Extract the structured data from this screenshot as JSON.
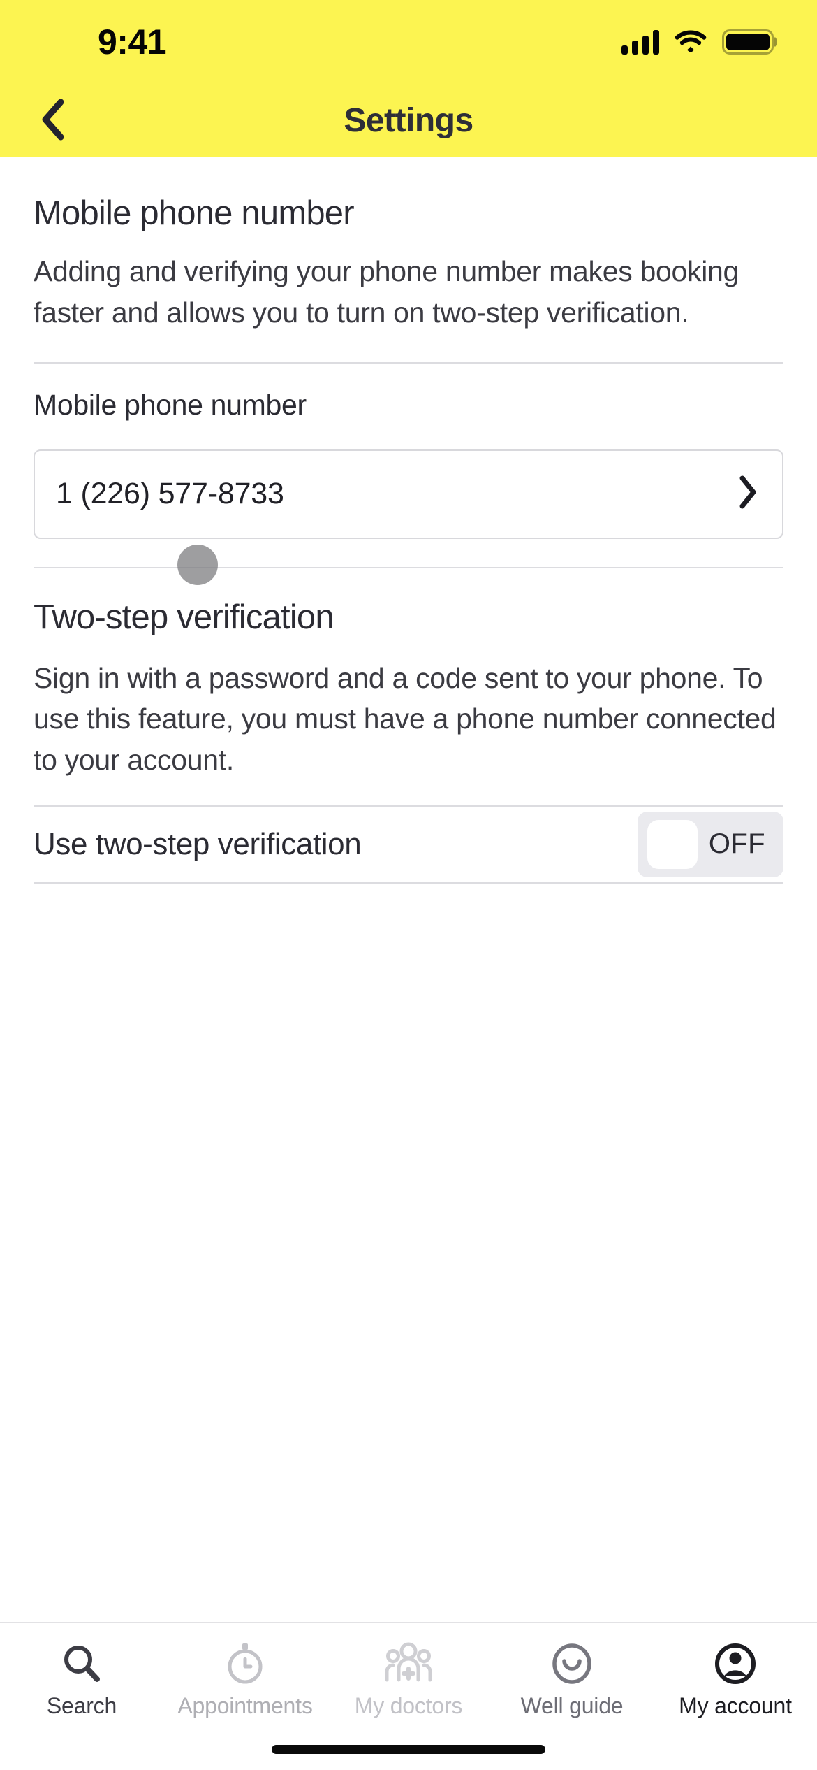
{
  "status_bar": {
    "time": "9:41",
    "cellular_icon": "cellular-signal-icon",
    "wifi_icon": "wifi-icon",
    "battery_icon": "battery-full-icon"
  },
  "header": {
    "back_icon": "chevron-left-icon",
    "title": "Settings",
    "background_color": "#FCF451",
    "title_color": "#2E2E38"
  },
  "sections": {
    "phone": {
      "title": "Mobile phone number",
      "description": "Adding and verifying your phone number makes booking faster and allows you to turn on two-step verification.",
      "field_label": "Mobile phone number",
      "field_value": "1 (226) 577-8733",
      "field_chevron_icon": "chevron-right-icon"
    },
    "two_step": {
      "title": "Two-step verification",
      "description": "Sign in with a password and a code sent to your phone. To use this feature, you must have a phone number connected to your account.",
      "toggle_label": "Use two-step verification",
      "toggle_state": "OFF"
    }
  },
  "tab_bar": {
    "tabs": [
      {
        "label": "Search",
        "icon": "magnifier-icon",
        "active": false
      },
      {
        "label": "Appointments",
        "icon": "stopwatch-icon",
        "active": false
      },
      {
        "label": "My doctors",
        "icon": "doctors-group-icon",
        "active": false
      },
      {
        "label": "Well guide",
        "icon": "smiley-icon",
        "active": false
      },
      {
        "label": "My account",
        "icon": "account-circle-icon",
        "active": true
      }
    ]
  },
  "home_indicator": "home-indicator-bar"
}
